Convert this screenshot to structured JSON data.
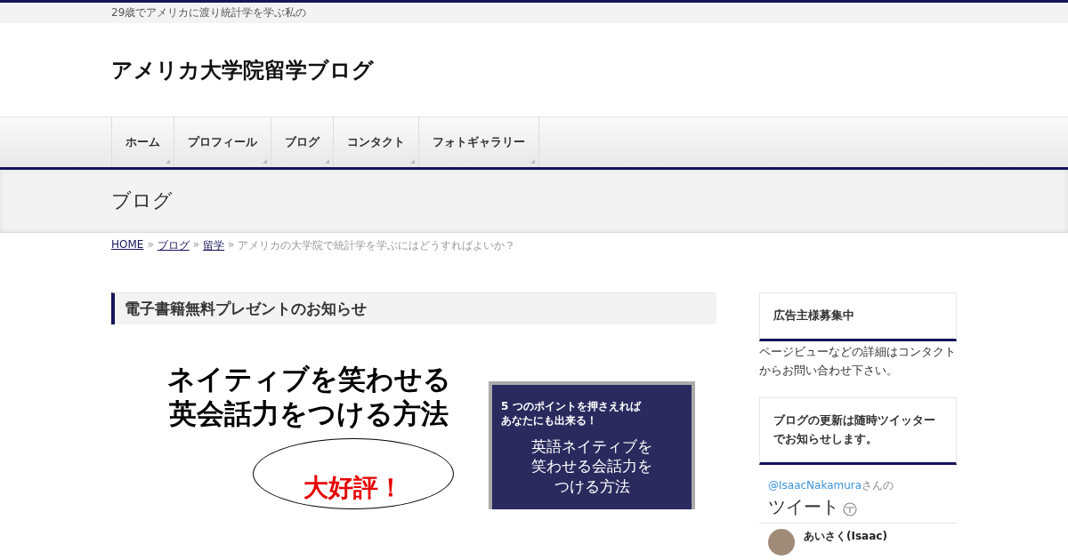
{
  "tagline": "29歳でアメリカに渡り統計学を学ぶ私の",
  "site_title": "アメリカ大学院留学ブログ",
  "nav": [
    {
      "label": "ホーム"
    },
    {
      "label": "プロフィール"
    },
    {
      "label": "ブログ"
    },
    {
      "label": "コンタクト"
    },
    {
      "label": "フォトギャラリー"
    }
  ],
  "page_title": "ブログ",
  "breadcrumb": {
    "links": [
      "HOME",
      "ブログ",
      "留学"
    ],
    "separator": "»",
    "current": "アメリカの大学院で統計学を学ぶにはどうすればよいか？"
  },
  "section_heading": "電子書籍無料プレゼントのお知らせ",
  "banner": {
    "headline": [
      "ネイティブを笑わせる",
      "英会話力をつける方法"
    ],
    "badge": "大好評！",
    "cover_subtitle": [
      "5 つのポイントを押さえれば",
      "あなたにも出来る！"
    ],
    "cover_title": [
      "英語ネイティブを",
      "笑わせる会話力を",
      "つける方法"
    ]
  },
  "sidebar": [
    {
      "kind": "text",
      "title": "広告主様募集中",
      "body": "ページビューなどの詳細はコンタクトからお問い合わせ下さい。"
    },
    {
      "kind": "twitter",
      "title": "ブログの更新は随時ツイッターでお知らせします。",
      "handle": "@IsaacNakamura",
      "handle_suffix": "さんの",
      "feed_title": "ツイート",
      "tweet_author": "あいさく(Isaac)"
    }
  ]
}
